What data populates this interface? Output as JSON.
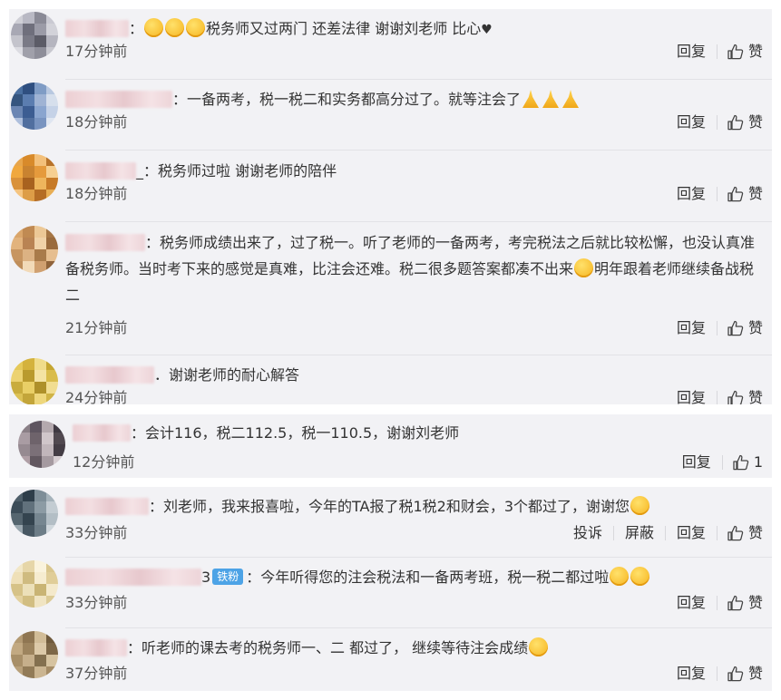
{
  "comments_top": [
    {
      "text_parts": [
        {
          "t": "name",
          "w": 70
        },
        {
          "t": "txt",
          "v": "："
        },
        {
          "t": "emoji"
        },
        {
          "t": "emoji"
        },
        {
          "t": "emoji"
        },
        {
          "t": "txt",
          "v": "税务师又过两门 还差法律 谢谢刘老师 比心"
        },
        {
          "t": "heart",
          "v": "♥"
        }
      ],
      "time": "17分钟前",
      "reply": "回复",
      "like": "赞",
      "avatar_colors": [
        "#cfcfd6",
        "#b9b9c4",
        "#8a8a96",
        "#c9c9d2",
        "#a8a8b4",
        "#6f6f7c",
        "#9b9ba7",
        "#d2d2d9",
        "#c4c4cc",
        "#7a7a86",
        "#5c5c67",
        "#b5b5bf",
        "#dcdce2",
        "#a0a0aa",
        "#8e8e99",
        "#c8c8cf"
      ]
    },
    {
      "text_parts": [
        {
          "t": "name",
          "w": 118
        },
        {
          "t": "txt",
          "v": "：一备两考，税一税二和实务都高分过了。就等注会了"
        },
        {
          "t": "pray"
        },
        {
          "t": "pray"
        },
        {
          "t": "pray"
        }
      ],
      "time": "18分钟前",
      "reply": "回复",
      "like": "赞",
      "avatar_colors": [
        "#4a6fa0",
        "#2f4f80",
        "#7f9cc5",
        "#b8c8e0",
        "#35557f",
        "#5b7db0",
        "#9fb3d4",
        "#d6dfec",
        "#6b86b3",
        "#3c5d92",
        "#8aa5cf",
        "#c5d2e7",
        "#aebfdc",
        "#516f9f",
        "#7994c0",
        "#dfe6f1"
      ]
    },
    {
      "text_parts": [
        {
          "t": "name",
          "w": 78
        },
        {
          "t": "txt",
          "v": "_：税务师过啦 谢谢老师的陪伴"
        }
      ],
      "time": "18分钟前",
      "reply": "回复",
      "like": "赞",
      "avatar_colors": [
        "#e7a54b",
        "#d88a2a",
        "#f3c07a",
        "#b8732a",
        "#f0a83e",
        "#c98330",
        "#e59a3c",
        "#f6cf91",
        "#d9913a",
        "#a8621f",
        "#eeb55c",
        "#c77a27",
        "#f5c47f",
        "#dd9d47",
        "#b56d25",
        "#e8ae55"
      ]
    },
    {
      "text_parts": [
        {
          "t": "name",
          "w": 88
        },
        {
          "t": "txt",
          "v": "：税务师成绩出来了，过了税一。听了老师的一备两考，考完税法之后就比较松懈，也没认真准备税务师。当时考下来的感觉是真难，比注会还难。税二很多题答案都凑不出来"
        },
        {
          "t": "emoji"
        },
        {
          "t": "txt",
          "v": "明年跟着老师继续备战税二"
        }
      ],
      "time": "21分钟前",
      "reply": "回复",
      "like": "赞",
      "avatar_colors": [
        "#d9a56a",
        "#c08a52",
        "#ecc896",
        "#a57645",
        "#e2b37d",
        "#b98353",
        "#f0d2a8",
        "#9a6b3d",
        "#c79561",
        "#dcb283",
        "#a97b4a",
        "#e6be8f",
        "#bf8e5b",
        "#f2dab8",
        "#d0a070",
        "#8f633a"
      ]
    },
    {
      "text_parts": [
        {
          "t": "name",
          "w": 98
        },
        {
          "t": "txt",
          "v": "．谢谢老师的耐心解答"
        }
      ],
      "time": "24分钟前",
      "reply": "回复",
      "like": "赞",
      "avatar_colors": [
        "#e5c95a",
        "#d4b23c",
        "#f0dc8a",
        "#c5a632",
        "#ecd272",
        "#b99a2e",
        "#f4e3a3",
        "#d9bc4b",
        "#c9ac3e",
        "#e9cf66",
        "#ae902a",
        "#f1dd91",
        "#dcc155",
        "#c3a53a",
        "#eed77d",
        "#d0b447"
      ]
    }
  ],
  "comment_mid": {
    "text_parts": [
      {
        "t": "name",
        "w": 64
      },
      {
        "t": "txt",
        "v": "：会计116，税二112.5，税一110.5，谢谢刘老师"
      }
    ],
    "time": "12分钟前",
    "reply": "回复",
    "like": "1",
    "avatar_colors": [
      "#8a7f86",
      "#5e5560",
      "#b4a9ae",
      "#3f3942",
      "#a99ca3",
      "#6e636b",
      "#d0c6ca",
      "#514950",
      "#968a91",
      "#7b7078",
      "#c1b6bb",
      "#443d45",
      "#b09fa6",
      "#625860",
      "#a59aa0",
      "#d6cdd1"
    ]
  },
  "comments_bottom": [
    {
      "text_parts": [
        {
          "t": "name",
          "w": 92
        },
        {
          "t": "txt",
          "v": "：刘老师，我来报喜啦，今年的TA报了税1税2和财会，3个都过了，谢谢您"
        },
        {
          "t": "emoji"
        }
      ],
      "time": "33分钟前",
      "extra": [
        "投诉",
        "屏蔽"
      ],
      "reply": "回复",
      "like": "赞",
      "avatar_colors": [
        "#4f5f6a",
        "#2e3e4a",
        "#7e8e98",
        "#a6b3bb",
        "#3c4c58",
        "#61717c",
        "#8c9ba4",
        "#c3ccd2",
        "#55656f",
        "#34444f",
        "#768690",
        "#b3bec5",
        "#9aa7af",
        "#475762",
        "#6d7d87",
        "#d0d7dc"
      ]
    },
    {
      "text_parts": [
        {
          "t": "name",
          "w": 150
        },
        {
          "t": "txt",
          "v": "3"
        },
        {
          "t": "badge",
          "v": "铁粉"
        },
        {
          "t": "txt",
          "v": "：今年听得您的注会税法和一备两考班，税一税二都过啦"
        },
        {
          "t": "emoji"
        },
        {
          "t": "emoji"
        }
      ],
      "time": "33分钟前",
      "reply": "回复",
      "like": "赞",
      "avatar_colors": [
        "#f2e7c7",
        "#e6d6a8",
        "#faf3dd",
        "#d9c68d",
        "#efe0b8",
        "#cfbb80",
        "#f6ecd0",
        "#e0cd98",
        "#d6c287",
        "#ece0b9",
        "#c9b474",
        "#f4e9cb",
        "#e3d19e",
        "#d2be82",
        "#f0e4c2",
        "#dccb96"
      ]
    },
    {
      "text_parts": [
        {
          "t": "name",
          "w": 68
        },
        {
          "t": "txt",
          "v": "：听老师的课去考的税务师一、二 都过了， 继续等待注会成绩"
        },
        {
          "t": "emoji"
        }
      ],
      "time": "37分钟前",
      "reply": "回复",
      "like": "赞",
      "avatar_colors": [
        "#b39a73",
        "#8f7652",
        "#d1bc97",
        "#6f5a3c",
        "#c2a982",
        "#9d845e",
        "#dcc9a8",
        "#7d6747",
        "#a88f68",
        "#c6af8b",
        "#84704f",
        "#d6c3a0",
        "#b8a07a",
        "#927b57",
        "#cbb591",
        "#a58c66"
      ]
    }
  ]
}
